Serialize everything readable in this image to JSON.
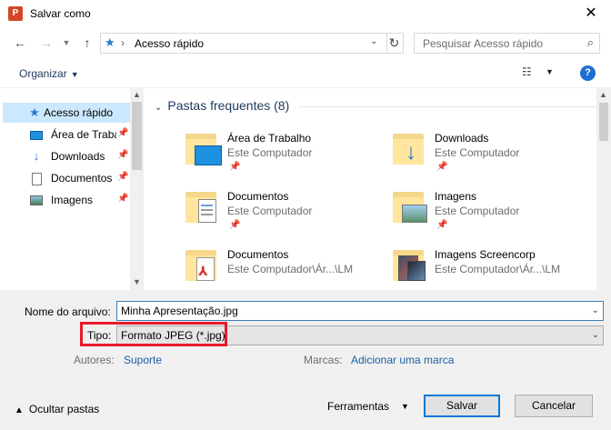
{
  "window": {
    "title": "Salvar como",
    "app_icon_letter": "P",
    "close_glyph": "✕"
  },
  "address": {
    "path": "Acesso rápido",
    "search_placeholder": "Pesquisar Acesso rápido"
  },
  "toolbar": {
    "organize": "Organizar"
  },
  "sidebar": {
    "items": [
      {
        "label": "Acesso rápido",
        "icon": "star-icon",
        "pinned": false
      },
      {
        "label": "Área de Trabalho",
        "icon": "desktop-icon",
        "pinned": true
      },
      {
        "label": "Downloads",
        "icon": "download-icon",
        "pinned": true
      },
      {
        "label": "Documentos",
        "icon": "document-icon",
        "pinned": true
      },
      {
        "label": "Imagens",
        "icon": "image-icon",
        "pinned": true
      }
    ]
  },
  "content": {
    "group_title": "Pastas frequentes (8)",
    "folders": [
      {
        "name": "Área de Trabalho",
        "location": "Este Computador",
        "pinned": true,
        "icon": "desktop-folder-icon"
      },
      {
        "name": "Downloads",
        "location": "Este Computador",
        "pinned": true,
        "icon": "downloads-folder-icon"
      },
      {
        "name": "Documentos",
        "location": "Este Computador",
        "pinned": true,
        "icon": "documents-folder-icon"
      },
      {
        "name": "Imagens",
        "location": "Este Computador",
        "pinned": true,
        "icon": "images-folder-icon"
      },
      {
        "name": "Documentos",
        "location": "Este Computador\\Ár...\\LM",
        "pinned": false,
        "icon": "pdf-folder-icon"
      },
      {
        "name": "Imagens Screencorp",
        "location": "Este Computador\\Ár...\\LM",
        "pinned": false,
        "icon": "photos-folder-icon"
      }
    ]
  },
  "form": {
    "filename_label": "Nome do arquivo:",
    "filename_value": "Minha Apresentação.jpg",
    "type_label": "Tipo:",
    "type_value": "Formato JPEG (*.jpg)",
    "authors_label": "Autores:",
    "authors_value": "Suporte",
    "tags_label": "Marcas:",
    "tags_value": "Adicionar uma marca"
  },
  "footer": {
    "hide_folders": "Ocultar pastas",
    "tools": "Ferramentas",
    "save": "Salvar",
    "cancel": "Cancelar"
  },
  "colors": {
    "highlight": "#e8192c",
    "selected": "#cce8ff",
    "link": "#1a5fa8",
    "accent": "#0078d7"
  }
}
